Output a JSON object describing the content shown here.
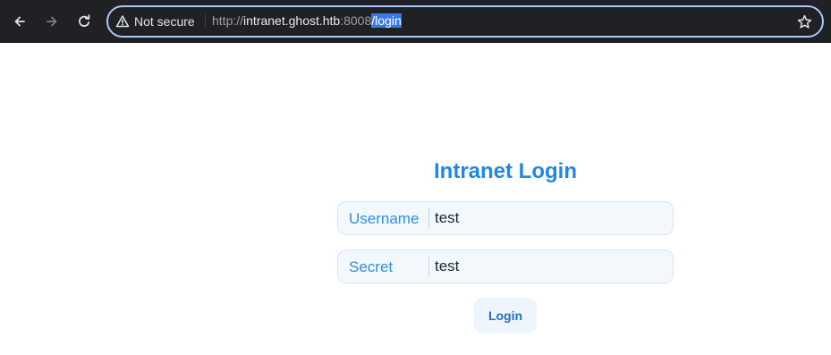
{
  "browser": {
    "security_label": "Not secure",
    "url": {
      "scheme": "http://",
      "host": "intranet.ghost.htb",
      "port": ":8008",
      "path": "/login"
    },
    "icons": {
      "back": "arrow-left-icon",
      "forward": "arrow-right-icon",
      "reload": "reload-icon",
      "security": "warning-triangle-icon",
      "bookmark": "star-icon"
    }
  },
  "login": {
    "title": "Intranet Login",
    "username_label": "Username",
    "username_value": "test",
    "secret_label": "Secret",
    "secret_value": "test",
    "button_label": "Login"
  },
  "colors": {
    "accent": "#1e88e5",
    "field_bg": "#f3f8fd",
    "toolbar_bg": "#202124",
    "url_selection": "#3b78e7"
  }
}
